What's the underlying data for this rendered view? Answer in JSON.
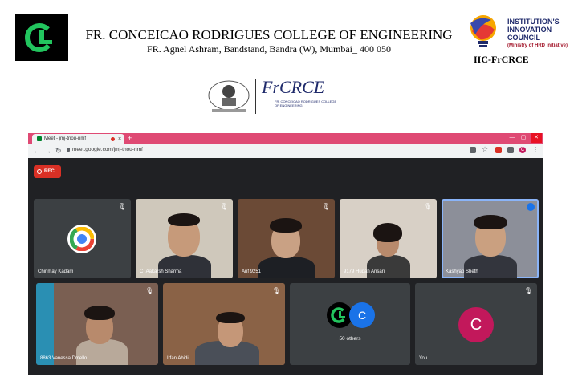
{
  "header": {
    "college_title": "FR. CONCEICAO RODRIGUES COLLEGE OF ENGINEERING",
    "college_address": "FR. Agnel Ashram, Bandstand, Bandra (W), Mumbai_ 400 050",
    "iic_line1": "INSTITUTION'S",
    "iic_line2": "INNOVATION",
    "iic_line3": "COUNCIL",
    "iic_line4": "(Ministry of HRD Initiative)",
    "iic_name": "IIC-FrCRCE",
    "frcrce_brand": "FrCRCE",
    "frcrce_sub": "FR. CONCEICAO RODRIGUES COLLEGE OF ENGINEERING"
  },
  "browser": {
    "tab_title": "Meet - jmj-tnou-nmf",
    "tab_close": "×",
    "new_tab": "+",
    "url": "meet.google.com/jmj-tnou-nmf",
    "profile_initial": "C"
  },
  "meet": {
    "rec_label": "REC",
    "participants": [
      {
        "name": "Chinmay Kadam"
      },
      {
        "name": "C_Aakarsh Sharma"
      },
      {
        "name": "Arif 9251"
      },
      {
        "name": "9179 Hudah Ansari"
      },
      {
        "name": "Kashyap Sheth"
      },
      {
        "name": "8863 Vanessa Dmello"
      },
      {
        "name": "Irfan Abidi"
      }
    ],
    "others_label": "50 others",
    "others_initial": "C",
    "you_label": "You",
    "you_initial": "C"
  },
  "colors": {
    "tabbar": "#df4a74",
    "meet_bg": "#202124",
    "tile_bg": "#3c4043",
    "rec": "#d93025",
    "you_avatar": "#c2185b",
    "others_avatar": "#1a73e8",
    "active_border": "#8ab4f8"
  }
}
